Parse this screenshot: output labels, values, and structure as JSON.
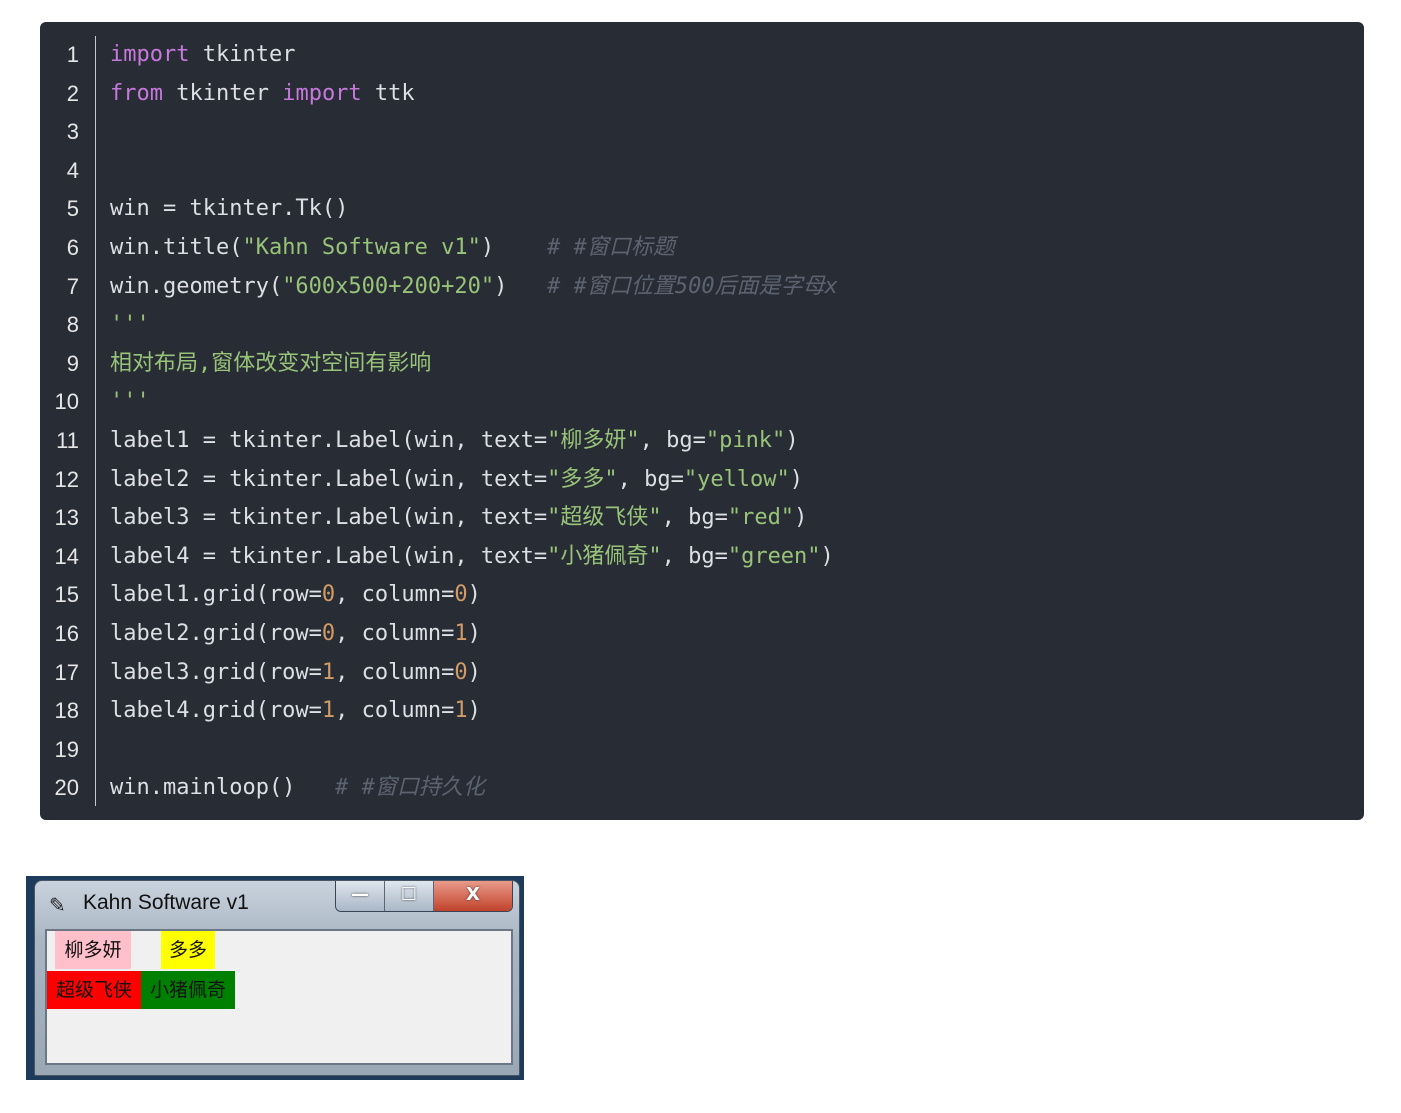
{
  "code": {
    "line_numbers": [
      "1",
      "2",
      "3",
      "4",
      "5",
      "6",
      "7",
      "8",
      "9",
      "10",
      "11",
      "12",
      "13",
      "14",
      "15",
      "16",
      "17",
      "18",
      "19",
      "20"
    ],
    "lines": [
      [
        {
          "t": "import",
          "c": "kw"
        },
        {
          "t": " tkinter",
          "c": ""
        }
      ],
      [
        {
          "t": "from",
          "c": "kw"
        },
        {
          "t": " tkinter ",
          "c": ""
        },
        {
          "t": "import",
          "c": "kw"
        },
        {
          "t": " ttk",
          "c": ""
        }
      ],
      [],
      [],
      [
        {
          "t": "win = tkinter.Tk()",
          "c": ""
        }
      ],
      [
        {
          "t": "win.title(",
          "c": ""
        },
        {
          "t": "\"Kahn Software v1\"",
          "c": "str"
        },
        {
          "t": ")    ",
          "c": ""
        },
        {
          "t": "# #窗口标题",
          "c": "cmt"
        }
      ],
      [
        {
          "t": "win.geometry(",
          "c": ""
        },
        {
          "t": "\"600x500+200+20\"",
          "c": "str"
        },
        {
          "t": ")   ",
          "c": ""
        },
        {
          "t": "# #窗口位置500后面是字母x",
          "c": "cmt"
        }
      ],
      [
        {
          "t": "'''",
          "c": "doc"
        }
      ],
      [
        {
          "t": "相对布局,窗体改变对空间有影响",
          "c": "doc"
        }
      ],
      [
        {
          "t": "'''",
          "c": "doc"
        }
      ],
      [
        {
          "t": "label1 = tkinter.Label(win, text=",
          "c": ""
        },
        {
          "t": "\"柳多妍\"",
          "c": "str"
        },
        {
          "t": ", bg=",
          "c": ""
        },
        {
          "t": "\"pink\"",
          "c": "str"
        },
        {
          "t": ")",
          "c": ""
        }
      ],
      [
        {
          "t": "label2 = tkinter.Label(win, text=",
          "c": ""
        },
        {
          "t": "\"多多\"",
          "c": "str"
        },
        {
          "t": ", bg=",
          "c": ""
        },
        {
          "t": "\"yellow\"",
          "c": "str"
        },
        {
          "t": ")",
          "c": ""
        }
      ],
      [
        {
          "t": "label3 = tkinter.Label(win, text=",
          "c": ""
        },
        {
          "t": "\"超级飞侠\"",
          "c": "str"
        },
        {
          "t": ", bg=",
          "c": ""
        },
        {
          "t": "\"red\"",
          "c": "str"
        },
        {
          "t": ")",
          "c": ""
        }
      ],
      [
        {
          "t": "label4 = tkinter.Label(win, text=",
          "c": ""
        },
        {
          "t": "\"小猪佩奇\"",
          "c": "str"
        },
        {
          "t": ", bg=",
          "c": ""
        },
        {
          "t": "\"green\"",
          "c": "str"
        },
        {
          "t": ")",
          "c": ""
        }
      ],
      [
        {
          "t": "label1.grid(row=",
          "c": ""
        },
        {
          "t": "0",
          "c": "num"
        },
        {
          "t": ", column=",
          "c": ""
        },
        {
          "t": "0",
          "c": "num"
        },
        {
          "t": ")",
          "c": ""
        }
      ],
      [
        {
          "t": "label2.grid(row=",
          "c": ""
        },
        {
          "t": "0",
          "c": "num"
        },
        {
          "t": ", column=",
          "c": ""
        },
        {
          "t": "1",
          "c": "num"
        },
        {
          "t": ")",
          "c": ""
        }
      ],
      [
        {
          "t": "label3.grid(row=",
          "c": ""
        },
        {
          "t": "1",
          "c": "num"
        },
        {
          "t": ", column=",
          "c": ""
        },
        {
          "t": "0",
          "c": "num"
        },
        {
          "t": ")",
          "c": ""
        }
      ],
      [
        {
          "t": "label4.grid(row=",
          "c": ""
        },
        {
          "t": "1",
          "c": "num"
        },
        {
          "t": ", column=",
          "c": ""
        },
        {
          "t": "1",
          "c": "num"
        },
        {
          "t": ")",
          "c": ""
        }
      ],
      [],
      [
        {
          "t": "win.mainloop()   ",
          "c": ""
        },
        {
          "t": "# #窗口持久化",
          "c": "cmt"
        }
      ]
    ]
  },
  "tk_window": {
    "title": "Kahn Software v1",
    "icon": "feather-icon",
    "controls": {
      "minimize": "—",
      "maximize": "☐",
      "close": "X"
    },
    "labels": [
      {
        "text": "柳多妍",
        "bg": "#ffc0cb"
      },
      {
        "text": "多多",
        "bg": "#ffff00"
      },
      {
        "text": "超级飞侠",
        "bg": "#ff0000"
      },
      {
        "text": "小猪佩奇",
        "bg": "#008000"
      }
    ]
  }
}
